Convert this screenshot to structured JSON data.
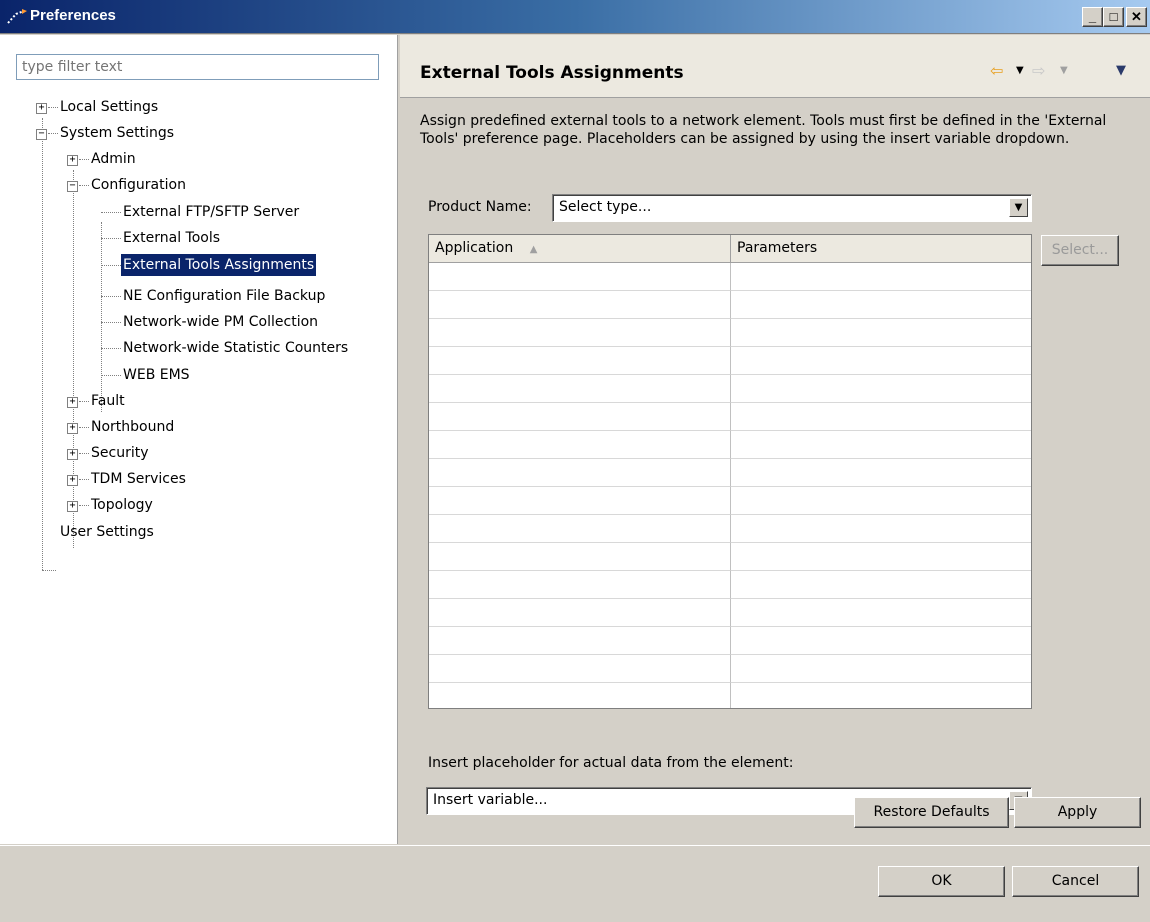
{
  "window": {
    "title": "Preferences",
    "minimize": "_",
    "maximize": "□",
    "close": "✕"
  },
  "filter": {
    "placeholder": "type filter text"
  },
  "tree": {
    "local_settings": "Local Settings",
    "system_settings": "System Settings",
    "admin": "Admin",
    "configuration": "Configuration",
    "external_ftp": "External FTP/SFTP Server",
    "external_tools": "External Tools",
    "external_tools_assignments": "External Tools Assignments",
    "ne_config_backup": "NE Configuration File Backup",
    "pm_collection": "Network-wide PM Collection",
    "statistic_counters": "Network-wide Statistic Counters",
    "web_ems": "WEB EMS",
    "fault": "Fault",
    "northbound": "Northbound",
    "security": "Security",
    "tdm_services": "TDM Services",
    "topology": "Topology",
    "user_settings": "User Settings"
  },
  "page": {
    "title": "External Tools Assignments",
    "description": "Assign predefined external tools to a network element. Tools must first be defined in the 'External Tools' preference page. Placeholders can be assigned by using the insert variable dropdown.",
    "product_name_label": "Product Name:",
    "product_name_value": "Select type...",
    "table": {
      "columns": [
        "Application",
        "Parameters"
      ],
      "rows": []
    },
    "select_button": "Select...",
    "placeholder_label": "Insert placeholder for actual data from the element:",
    "insert_variable_value": "Insert variable...",
    "restore_defaults": "Restore Defaults",
    "apply": "Apply"
  },
  "dialog": {
    "ok": "OK",
    "cancel": "Cancel"
  },
  "colors": {
    "selection": "#0a246a",
    "face": "#d4d0c8",
    "back_arrow": "#f0b030"
  }
}
